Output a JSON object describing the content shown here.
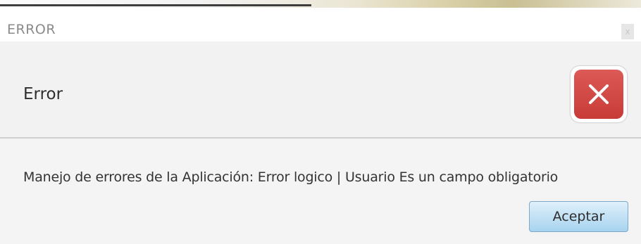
{
  "window": {
    "title": "ERROR",
    "close_label": "x"
  },
  "header": {
    "text": "Error",
    "icon": "error-x-icon",
    "icon_color": "#c83b37"
  },
  "content": {
    "message": "Manejo de errores de la Aplicación: Error logico | Usuario Es un campo obligatorio"
  },
  "buttons": {
    "ok_label": "Aceptar"
  }
}
